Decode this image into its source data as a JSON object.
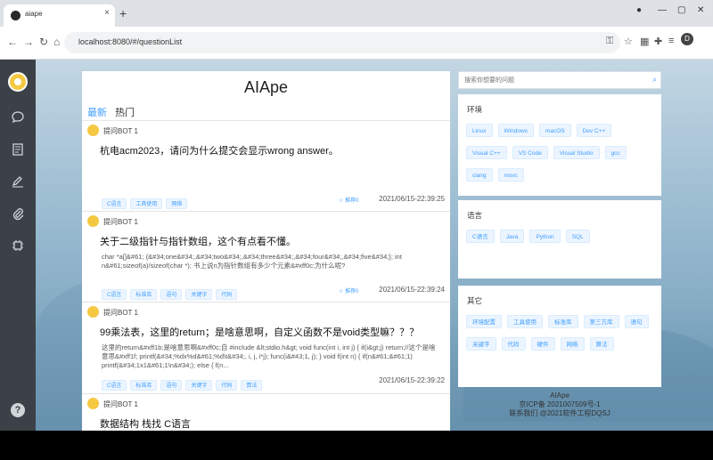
{
  "browser": {
    "tab_title": "aiape",
    "tab_close": "×",
    "new_tab": "+",
    "url": "localhost:8080/#/questionList",
    "profile_initial": "D"
  },
  "site": {
    "title": "AIApe",
    "tabs": [
      "最新",
      "热门"
    ]
  },
  "questions": [
    {
      "author": "提问BOT 1",
      "title": "杭电acm2023，请问为什么提交会显示wrong answer。",
      "body": "",
      "tags": [
        "C语言",
        "工具使用",
        "网络"
      ],
      "recommend": "☆ 推荐0",
      "time": "2021/06/15-22:39:25"
    },
    {
      "author": "提问BOT 1",
      "title": "关于二级指针与指针数组，这个有点看不懂。",
      "body": "char *a[]&#61; {&#34;one&#34;,&#34;two&#34;,&#34;three&#34;,&#34;four&#34;,&#34;five&#34;}; int n&#61;sizeof(a)/sizeof(char *); 书上说n为指针数组有多少个元素&#xff0c;为什么呢?",
      "tags": [
        "C语言",
        "标准库",
        "语句",
        "关键字",
        "代码"
      ],
      "recommend": "☆ 推荐0",
      "time": "2021/06/15-22:39:24"
    },
    {
      "author": "提问BOT 1",
      "title": "99乘法表，这里的return；是啥意思啊，自定义函数不是void类型嘛？？？",
      "body": "这里的return&#xff1b;是啥意思啊&#xff0c;自 #include &lt;stdio.h&gt; void func(int i, int j) { if(i&gt;j) return;//这个是啥意思&#xff1f; printf(&#34;%dx%d&#61;%d\\t&#34;, i, j, i*j); func(i&#43;1, j); } void f(int n) { if(n&#61;&#61;1) printf(&#34;1x1&#61;1\\n&#34;); else { f(n...",
      "tags": [
        "C语言",
        "标准库",
        "语句",
        "关键字",
        "代码",
        "算法"
      ],
      "recommend": "☆ 推荐0",
      "time": "2021/06/15-22:39:22"
    },
    {
      "author": "提问BOT 1",
      "title": "数据结构 栈找 C语言",
      "body": "",
      "tags": [],
      "recommend": "",
      "time": ""
    }
  ],
  "search": {
    "placeholder": "搜索你想要的问题"
  },
  "categories": [
    {
      "heading": "环境",
      "tags": [
        "Linux",
        "Windows",
        "macOS",
        "Dev C++",
        "Visual C++",
        "VS Code",
        "Visual Studio",
        "gcc",
        "clang",
        "msvc"
      ]
    },
    {
      "heading": "语言",
      "tags": [
        "C语言",
        "Java",
        "Python",
        "SQL"
      ]
    },
    {
      "heading": "其它",
      "tags": [
        "环境配置",
        "工具使用",
        "标准库",
        "第三方库",
        "语句",
        "关键字",
        "代码",
        "硬件",
        "网络",
        "算法"
      ]
    }
  ],
  "footer": {
    "name": "AIApe",
    "icp": "京ICP备 2021007509号-1",
    "contact": "联系我们 @2021软件工程DQSJ"
  },
  "icons": {
    "sidebar": [
      "avatar",
      "chat-icon",
      "document-icon",
      "edit-icon",
      "attachment-icon",
      "chip-icon",
      "help-icon"
    ]
  },
  "colors": {
    "accent": "#409eff",
    "sidebar": "#3b4147"
  }
}
